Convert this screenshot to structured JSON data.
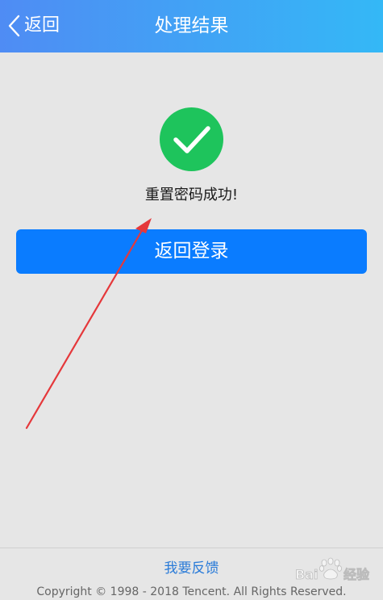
{
  "header": {
    "back_label": "返回",
    "title": "处理结果"
  },
  "result": {
    "icon": "success-check-icon",
    "message": "重置密码成功!"
  },
  "actions": {
    "return_login_label": "返回登录"
  },
  "footer": {
    "feedback_label": "我要反馈",
    "copyright": "Copyright © 1998 - 2018 Tencent. All Rights Reserved."
  },
  "watermark": {
    "text": "Bai 经验"
  },
  "colors": {
    "header_start": "#4f8cf4",
    "header_end": "#34b8f6",
    "success_green": "#1ec45c",
    "primary_blue": "#0a7cff",
    "annotation_red": "#e5383b",
    "link_blue": "#2a7bd8"
  }
}
